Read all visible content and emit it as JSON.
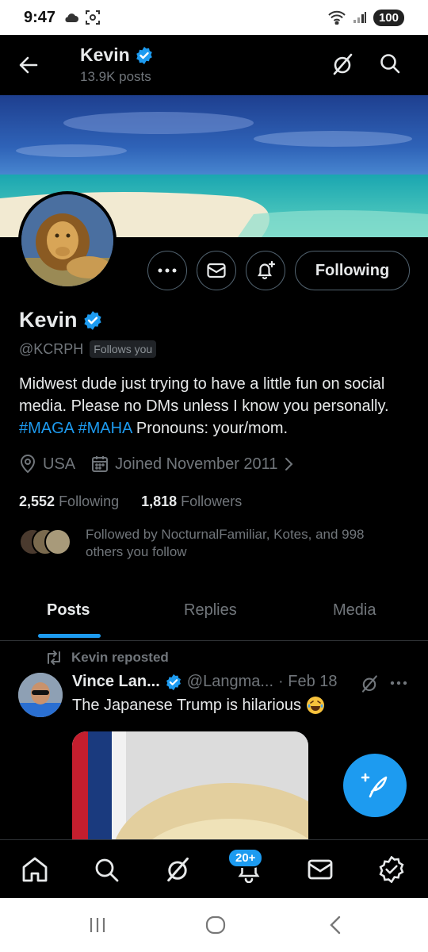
{
  "status_bar": {
    "time": "9:47",
    "battery": "100"
  },
  "header": {
    "title": "Kevin",
    "subtitle": "13.9K posts"
  },
  "profile": {
    "name": "Kevin",
    "handle": "@KCRPH",
    "follows_you_badge": "Follows you",
    "bio_prefix": "Midwest dude just trying to have a little fun on social media. Please no DMs unless I know you personally. ",
    "bio_tag1": "#MAGA",
    "bio_tag2": "#MAHA",
    "bio_suffix": " Pronouns: your/mom.",
    "location": "USA",
    "joined": "Joined November 2011",
    "following_count": "2,552",
    "following_label": "Following",
    "followers_count": "1,818",
    "followers_label": "Followers",
    "followed_by": "Followed by NocturnalFamiliar, Kotes, and 998 others you follow"
  },
  "actions": {
    "follow_button": "Following"
  },
  "tabs": [
    {
      "label": "Posts",
      "active": true
    },
    {
      "label": "Replies",
      "active": false
    },
    {
      "label": "Media",
      "active": false
    }
  ],
  "tweet": {
    "repost_label": "Kevin reposted",
    "author_name": "Vince Lan...",
    "author_handle": "@Langma...",
    "date": "· Feb 18",
    "text": "The Japanese Trump is hilarious"
  },
  "bottom_nav": {
    "notifications_badge": "20+"
  },
  "colors": {
    "accent": "#1d9bf0",
    "background": "#000000",
    "muted": "#71767b",
    "text": "#e7e9ea"
  },
  "icons": [
    "arrow-left-icon",
    "grok-icon",
    "search-icon",
    "more-icon",
    "mail-icon",
    "bell-plus-icon",
    "verified-icon",
    "location-icon",
    "calendar-icon",
    "chevron-right-icon",
    "repost-icon",
    "compose-icon",
    "home-icon",
    "bell-icon",
    "verified-nav-icon"
  ]
}
